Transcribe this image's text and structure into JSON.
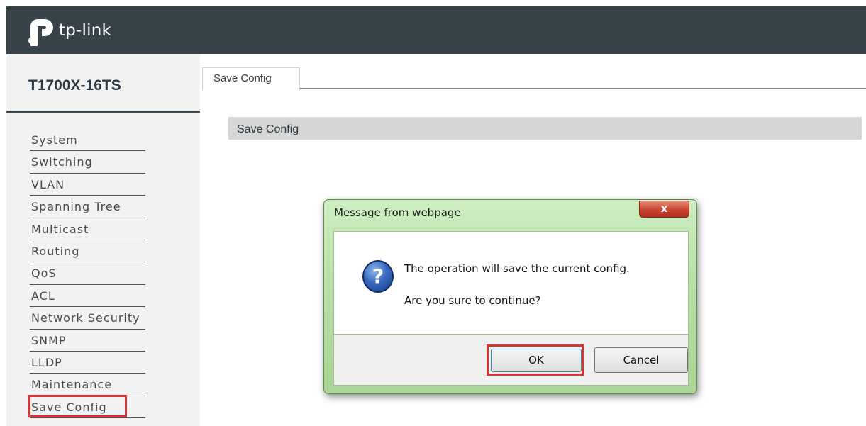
{
  "brand": {
    "name": "tp-link"
  },
  "sidebar": {
    "model": "T1700X-16TS",
    "items": [
      {
        "label": "System"
      },
      {
        "label": "Switching"
      },
      {
        "label": "VLAN"
      },
      {
        "label": "Spanning Tree"
      },
      {
        "label": "Multicast"
      },
      {
        "label": "Routing"
      },
      {
        "label": "QoS"
      },
      {
        "label": "ACL"
      },
      {
        "label": "Network Security"
      },
      {
        "label": "SNMP"
      },
      {
        "label": "LLDP"
      },
      {
        "label": "Maintenance"
      },
      {
        "label": "Save Config"
      }
    ],
    "selected": "Save Config"
  },
  "main": {
    "tab_label": "Save Config",
    "section_title": "Save Config"
  },
  "dialog": {
    "title": "Message from webpage",
    "close_label": "x",
    "message_line1": "The operation will save the current config.",
    "message_line2": "Are you sure to continue?",
    "ok_label": "OK",
    "cancel_label": "Cancel",
    "icon": "question-icon"
  },
  "colors": {
    "header": "#374348",
    "highlight": "#d93434"
  }
}
